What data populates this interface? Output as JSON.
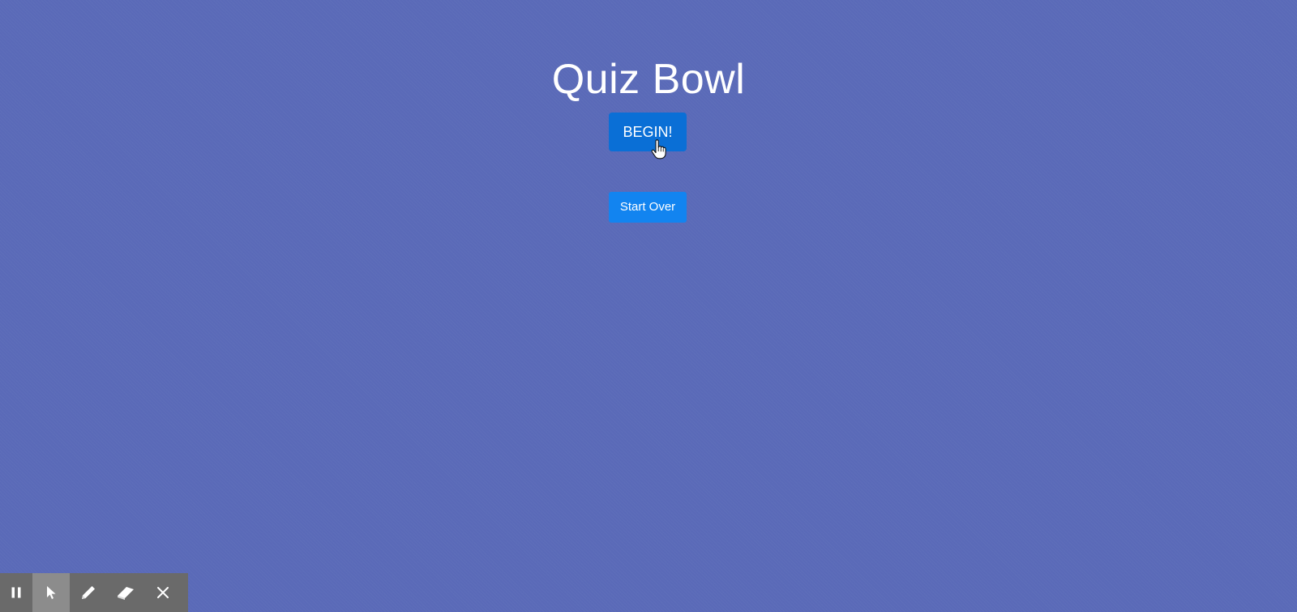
{
  "page": {
    "title": "Quiz Bowl",
    "background_color": "#5a6ab8"
  },
  "buttons": {
    "begin_label": "BEGIN!",
    "start_over_label": "Start Over",
    "begin_color": "#0a6fd6",
    "start_over_color": "#1284f0"
  },
  "toolbar": {
    "tools": [
      {
        "icon": "pause-icon"
      },
      {
        "icon": "pointer-icon",
        "active": true
      },
      {
        "icon": "pencil-icon"
      },
      {
        "icon": "eraser-icon"
      },
      {
        "icon": "close-icon"
      }
    ]
  }
}
